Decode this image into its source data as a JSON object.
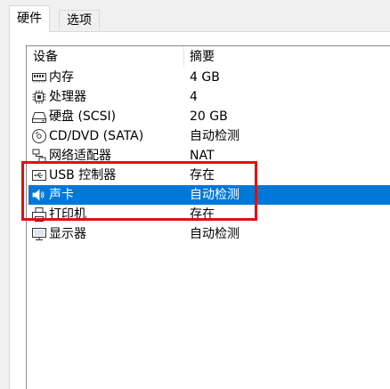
{
  "tabs": [
    {
      "label": "硬件"
    },
    {
      "label": "选项"
    }
  ],
  "columns": {
    "device": "设备",
    "summary": "摘要"
  },
  "devices": [
    {
      "name": "内存",
      "summary": "4 GB",
      "icon": "memory-icon"
    },
    {
      "name": "处理器",
      "summary": "4",
      "icon": "processor-icon"
    },
    {
      "name": "硬盘 (SCSI)",
      "summary": "20 GB",
      "icon": "hard-disk-icon"
    },
    {
      "name": "CD/DVD (SATA)",
      "summary": "自动检测",
      "icon": "cd-dvd-icon"
    },
    {
      "name": "网络适配器",
      "summary": "NAT",
      "icon": "network-adapter-icon"
    },
    {
      "name": "USB 控制器",
      "summary": "存在",
      "icon": "usb-icon"
    },
    {
      "name": "声卡",
      "summary": "自动检测",
      "icon": "sound-card-icon"
    },
    {
      "name": "打印机",
      "summary": "存在",
      "icon": "printer-icon"
    },
    {
      "name": "显示器",
      "summary": "自动检测",
      "icon": "display-icon"
    }
  ],
  "selected_device": "声卡",
  "colors": {
    "selection": "#0078d7",
    "annotation": "#e01010"
  }
}
